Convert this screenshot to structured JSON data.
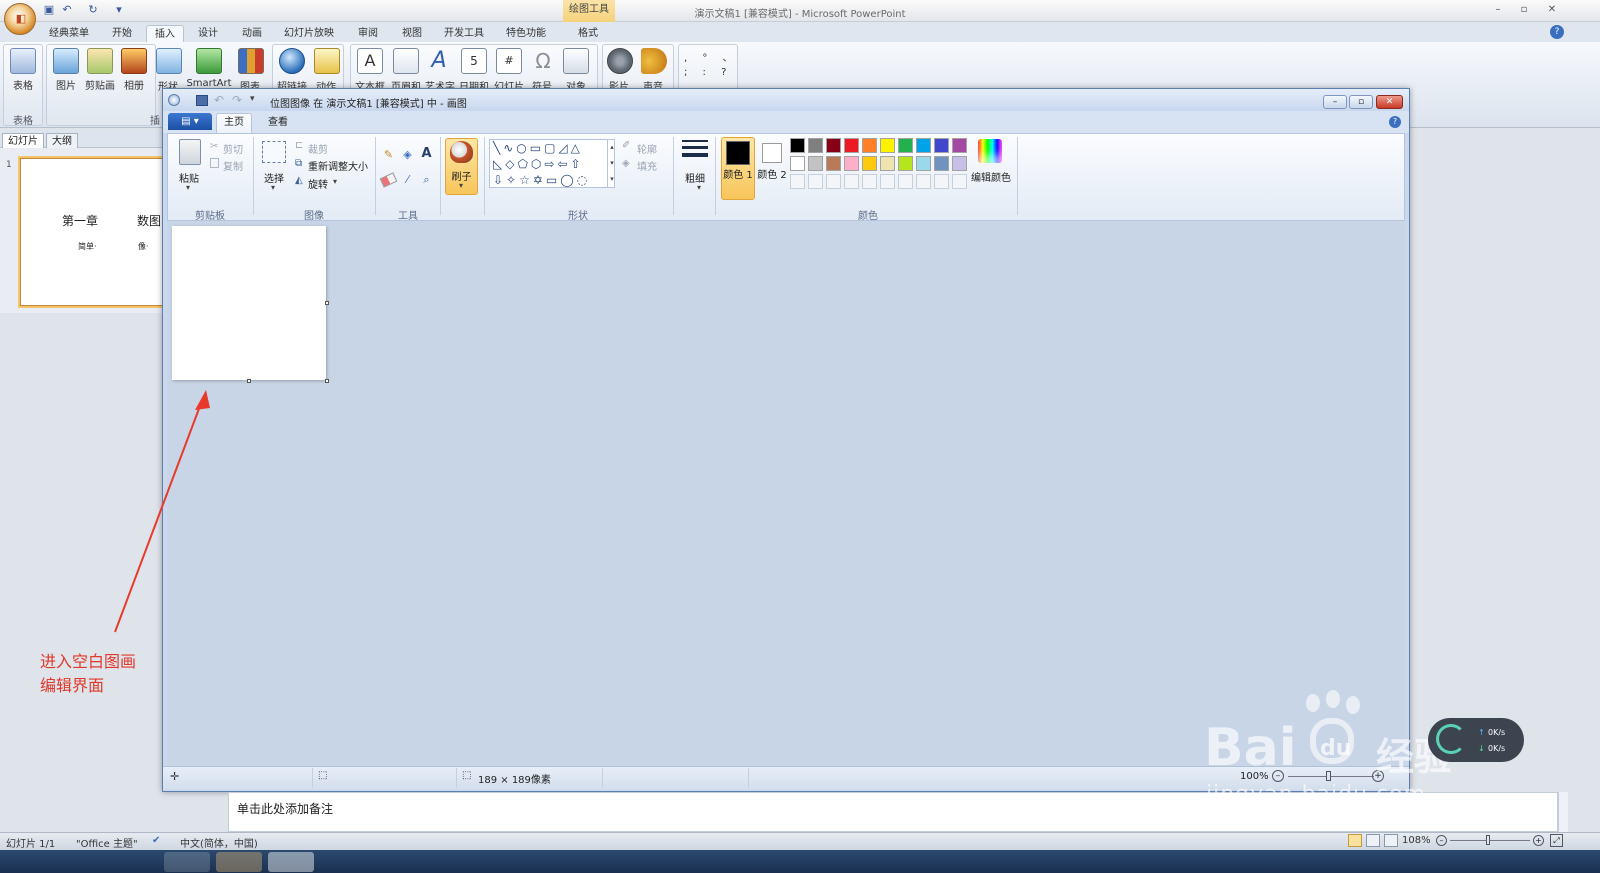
{
  "powerpoint": {
    "window_title": "演示文稿1 [兼容模式] - Microsoft PowerPoint",
    "contextual_tab": "绘图工具",
    "tabs": [
      "经典菜单",
      "开始",
      "插入",
      "设计",
      "动画",
      "幻灯片放映",
      "审阅",
      "视图",
      "开发工具",
      "特色功能",
      "格式"
    ],
    "active_tab": "插入",
    "ribbon": {
      "buttons": [
        "表格",
        "图片",
        "剪贴画",
        "相册",
        "形状",
        "SmartArt",
        "图表",
        "超链接",
        "动作",
        "文本框",
        "页眉和",
        "艺术字",
        "日期和",
        "幻灯片",
        "符号",
        "对象",
        "影片",
        "声音"
      ],
      "groups": [
        "表格",
        "插"
      ]
    },
    "panel_tabs": [
      "幻灯片",
      "大纲"
    ],
    "slide_number": "1",
    "slide_thumb_texts": [
      "第一章",
      "数图",
      "简单·",
      "像·"
    ],
    "notes_placeholder": "单击此处添加备注",
    "status": {
      "slide": "幻灯片 1/1",
      "theme": "\"Office 主题\"",
      "language": "中文(简体，中国)",
      "zoom": "108%"
    }
  },
  "paint": {
    "window_title": "位图图像 在 演示文稿1 [兼容模式] 中 - 画图",
    "tabs": [
      "主页",
      "查看"
    ],
    "active_tab": "主页",
    "clipboard": {
      "paste": "粘贴",
      "cut": "剪切",
      "copy": "复制",
      "label": "剪贴板"
    },
    "image": {
      "select": "选择",
      "crop": "裁剪",
      "resize": "重新调整大小",
      "rotate": "旋转",
      "label": "图像"
    },
    "tools": {
      "label": "工具"
    },
    "brush": {
      "label": "刷子"
    },
    "shapes": {
      "outline": "轮廓",
      "fill": "填充",
      "label": "形状"
    },
    "size": {
      "label": "粗细"
    },
    "colors": {
      "color1": "颜色 1",
      "color2": "颜色 2",
      "edit": "编辑颜色",
      "label": "颜色",
      "palette_row1": [
        "#000000",
        "#7f7f7f",
        "#880015",
        "#ed1c24",
        "#ff7f27",
        "#fff200",
        "#22b14c",
        "#00a2e8",
        "#3f48cc",
        "#a349a4"
      ],
      "palette_row2": [
        "#ffffff",
        "#c3c3c3",
        "#b97a57",
        "#ffaec9",
        "#ffc90e",
        "#efe4b0",
        "#b5e61d",
        "#99d9ea",
        "#7092be",
        "#c8bfe7"
      ]
    },
    "status": {
      "image_size": "189 × 189像素",
      "zoom": "100%"
    }
  },
  "annotation": {
    "line1": "进入空白图画",
    "line2": "编辑界面"
  },
  "watermark": {
    "brand": "Bai",
    "brand2": "du",
    "suffix": "经验",
    "url": "jingyan.baidu.com"
  },
  "net_widget": {
    "up": "0K/s",
    "down": "0K/s"
  }
}
